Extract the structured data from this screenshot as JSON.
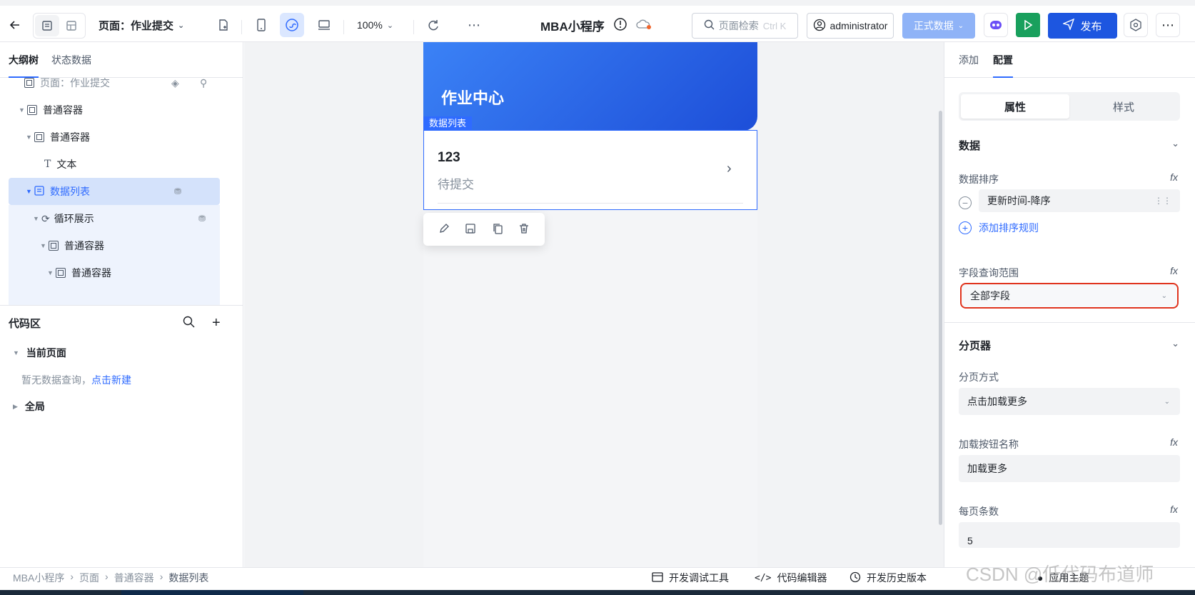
{
  "topbar": {
    "page_label": "页面：作业提交",
    "zoom": "100%",
    "app_title": "MBA小程序",
    "search_placeholder": "页面检索",
    "search_shortcut": "Ctrl K",
    "user": "administrator",
    "env": "正式数据",
    "publish": "发布"
  },
  "left": {
    "tabs": [
      "大纲树",
      "状态数据"
    ],
    "tree": [
      {
        "label": "页面：作业提交"
      },
      {
        "label": "普通容器"
      },
      {
        "label": "普通容器"
      },
      {
        "label": "文本"
      },
      {
        "label": "数据列表"
      },
      {
        "label": "循环展示"
      },
      {
        "label": "普通容器"
      },
      {
        "label": "普通容器"
      }
    ],
    "code_title": "代码区",
    "current_page": "当前页面",
    "empty_hint": "暂无数据查询，",
    "create_link": "点击新建",
    "global": "全局"
  },
  "canvas": {
    "header_title": "作业中心",
    "list_tag": "数据列表",
    "card_number": "123",
    "card_status": "待提交"
  },
  "right": {
    "tabs": [
      "添加",
      "配置"
    ],
    "seg": [
      "属性",
      "样式"
    ],
    "data_section": "数据",
    "sort_label": "数据排序",
    "sort_value": "更新时间-降序",
    "add_sort": "添加排序规则",
    "field_scope_label": "字段查询范围",
    "field_scope_value": "全部字段",
    "pager_section": "分页器",
    "pager_mode_label": "分页方式",
    "pager_mode_value": "点击加载更多",
    "load_btn_label": "加载按钮名称",
    "load_btn_value": "加载更多",
    "per_page_label": "每页条数",
    "per_page_value": "5"
  },
  "bottom": {
    "breadcrumb": [
      "MBA小程序",
      "页面",
      "普通容器",
      "数据列表"
    ],
    "debug": "开发调试工具",
    "code_editor": "代码编辑器",
    "history": "开发历史版本",
    "theme": "应用主题"
  },
  "watermark": "CSDN @低代码布道师"
}
